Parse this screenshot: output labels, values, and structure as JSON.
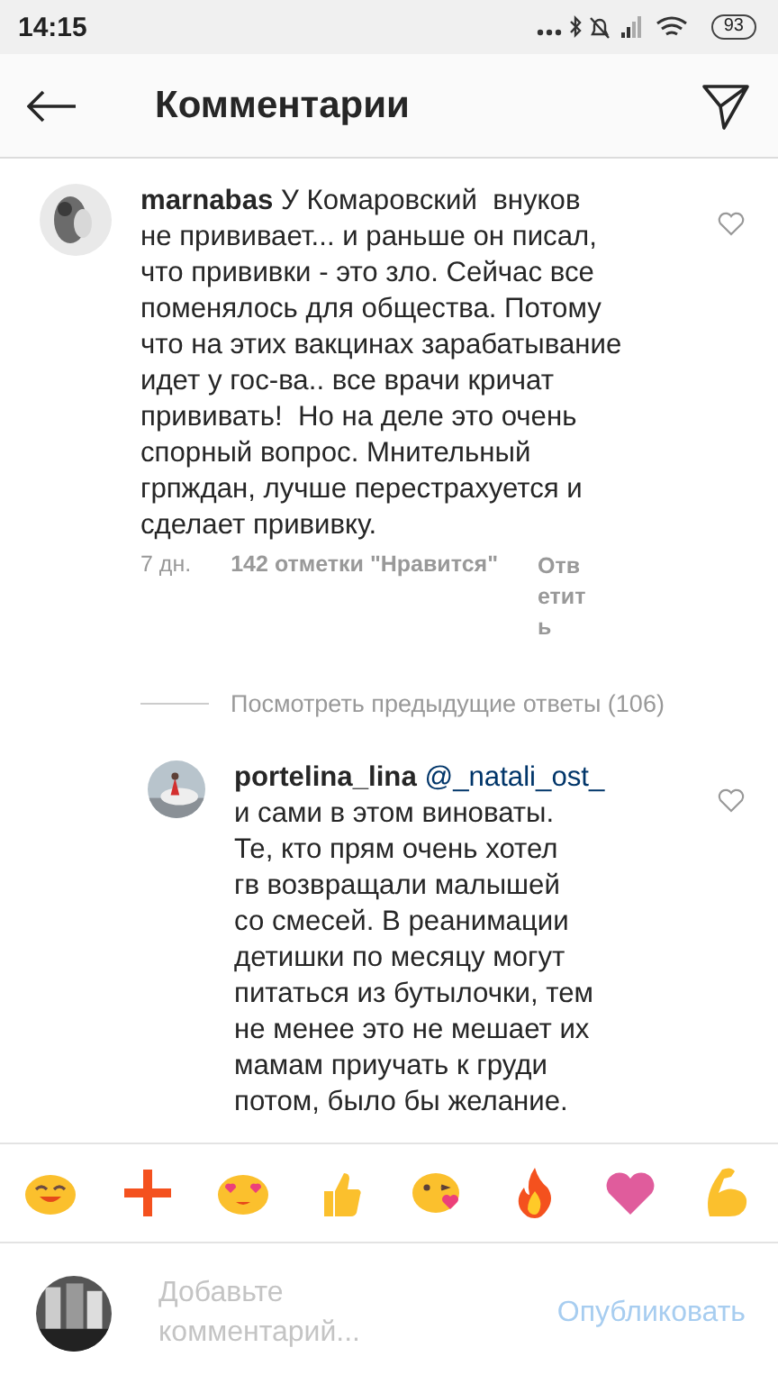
{
  "status_bar": {
    "time": "14:15",
    "battery": "93"
  },
  "header": {
    "title": "Комментарии"
  },
  "comments": [
    {
      "username": "marnabas",
      "lines": [
        "У Комаровский  внуков",
        "не прививает... и раньше он писал,",
        "что прививки - это зло. Сейчас все",
        "поменялось для общества. Потому",
        "что на этих вакцинах зарабатывание",
        "идет у гос-ва.. все врачи кричат",
        "прививать!  Но на деле это очень",
        "спорный вопрос. Мнительный",
        "грпждан, лучше перестрахуется и",
        "сделает прививку."
      ],
      "age": "7 дн.",
      "likes": "142 отметки \"Нравится\"",
      "reply": "Ответить",
      "liked": false,
      "kind": "top"
    },
    {
      "username": "portelina_lina",
      "mention": "@_natali_ost_",
      "lines": [
        "и сами в этом виноваты.",
        "Те, кто прям очень хотел",
        "гв возвращали малышей",
        "со смесей. В реанимации",
        "детишки по месяцу могут",
        "питаться из бутылочки, тем",
        "не менее это не мешает их",
        "мамам приучать к груди",
        "потом, было бы желание."
      ],
      "liked": false,
      "kind": "reply"
    }
  ],
  "view_replies": "Посмотреть предыдущие ответы (106)",
  "reactions": [
    {
      "kind": "grin"
    },
    {
      "kind": "plus"
    },
    {
      "kind": "heart-eyes"
    },
    {
      "kind": "thumbs-up"
    },
    {
      "kind": "kiss"
    },
    {
      "kind": "fire"
    },
    {
      "kind": "heart"
    },
    {
      "kind": "muscle"
    }
  ],
  "composer": {
    "placeholder": "Добавьте комментарий...",
    "button": "Опубликовать"
  }
}
